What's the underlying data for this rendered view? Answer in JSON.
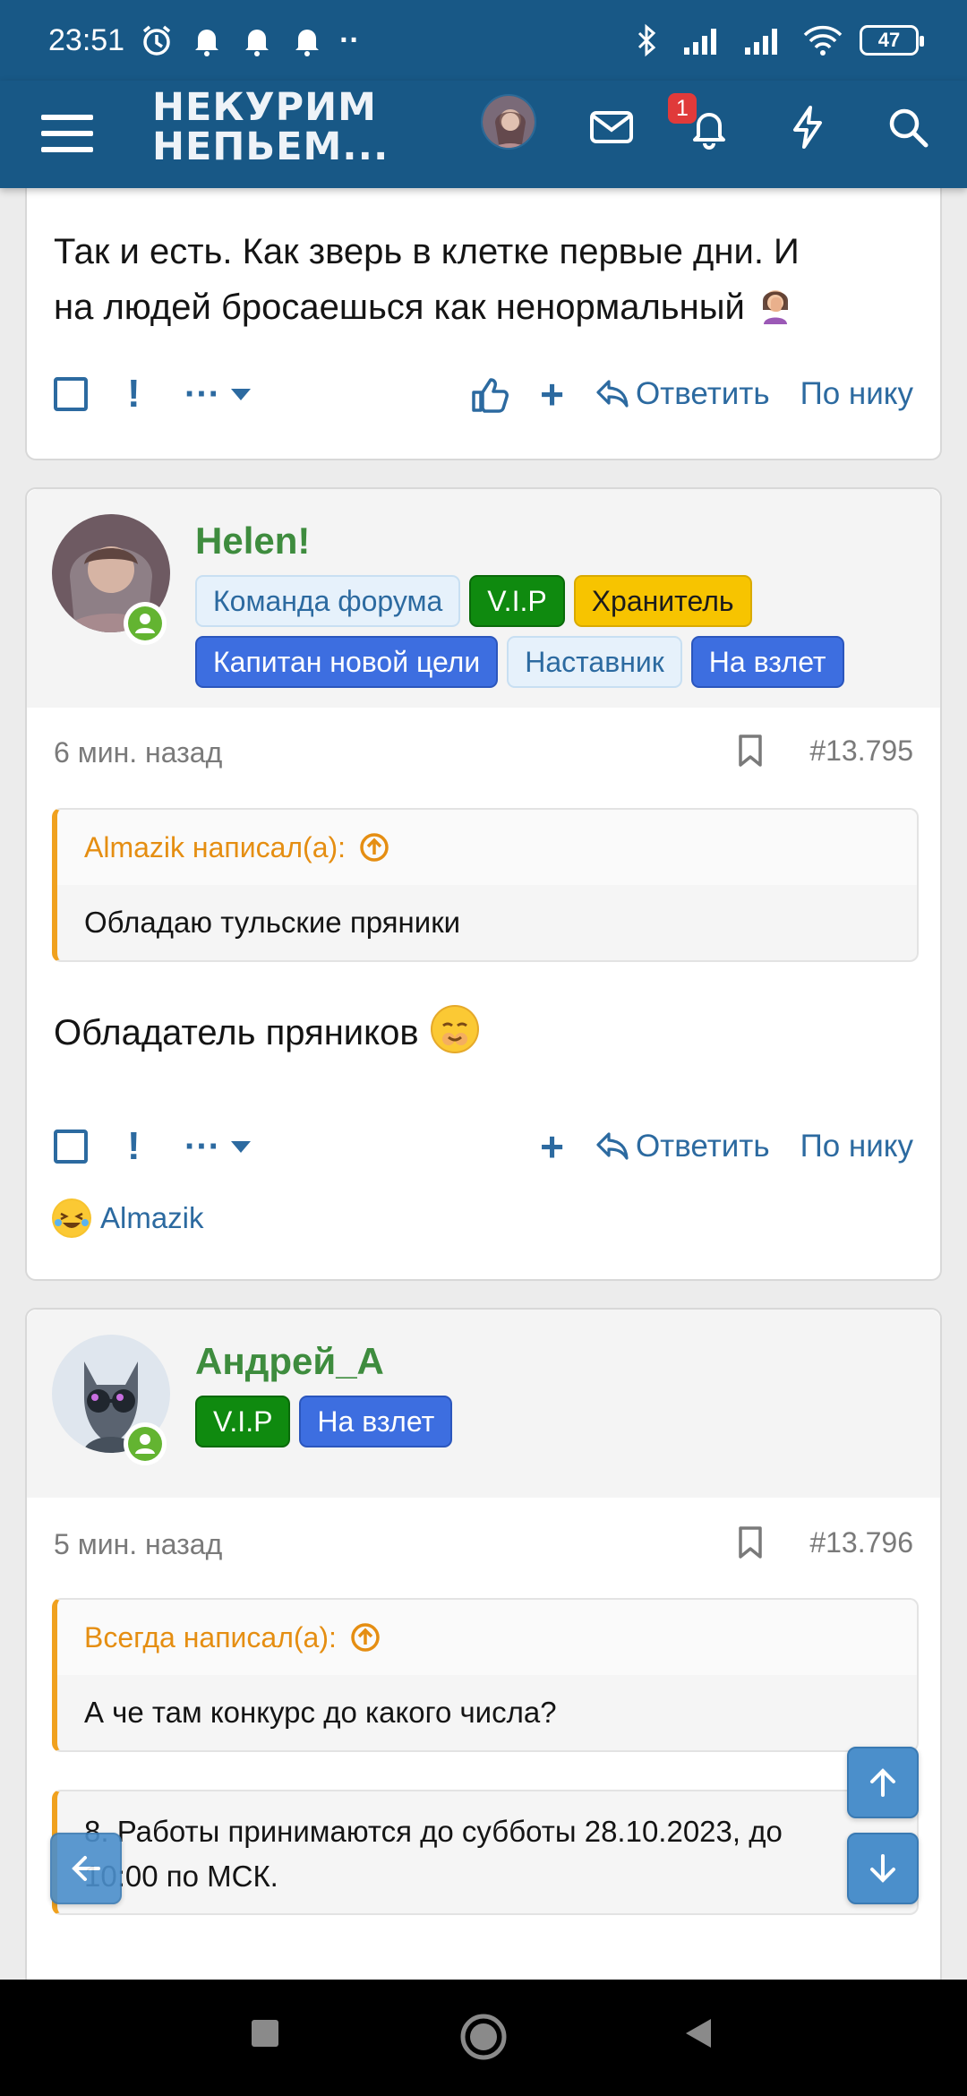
{
  "status_bar": {
    "time": "23:51",
    "dots": "··",
    "battery": "47"
  },
  "header": {
    "logo_line1": "НЕКУРИМ",
    "logo_line2": "НЕПЬЕМ...",
    "notification_count": "1",
    "icons": [
      "menu-icon",
      "avatar",
      "mail-icon",
      "bell-icon",
      "lightning-icon",
      "search-icon"
    ]
  },
  "post1": {
    "text_line1": "Так и есть. Как зверь в клетке первые дни. И",
    "text_line2": "на людей бросаешься как ненормальный",
    "reply_label": "Ответить",
    "by_nick_label": "По нику"
  },
  "post2": {
    "username": "Helen!",
    "badges": [
      "Команда форума",
      "V.I.P",
      "Хранитель",
      "Капитан новой цели",
      "Наставник",
      "На взлет"
    ],
    "time": "6 мин. назад",
    "post_number": "#13.795",
    "quote_author": "Almazik написал(а):",
    "quote_text": "Обладаю тульские пряники",
    "text": "Обладатель пряников",
    "reply_label": "Ответить",
    "by_nick_label": "По нику",
    "reaction_user": "Almazik"
  },
  "post3": {
    "username": "Андрей_А",
    "badges": [
      "V.I.P",
      "На взлет"
    ],
    "time": "5 мин. назад",
    "post_number": "#13.796",
    "quote_author": "Всегда написал(а):",
    "quote_text": "А че там конкурс до какого числа?",
    "quote2_line1": "8. Работы принимаются до субботы 28.10.2023, до",
    "quote2_line2": "10:00 по МСК."
  },
  "colors": {
    "header_bg": "#185886",
    "accent": "#2c6aa0",
    "username_green": "#3e8c3e",
    "quote_orange": "#e58e12"
  }
}
